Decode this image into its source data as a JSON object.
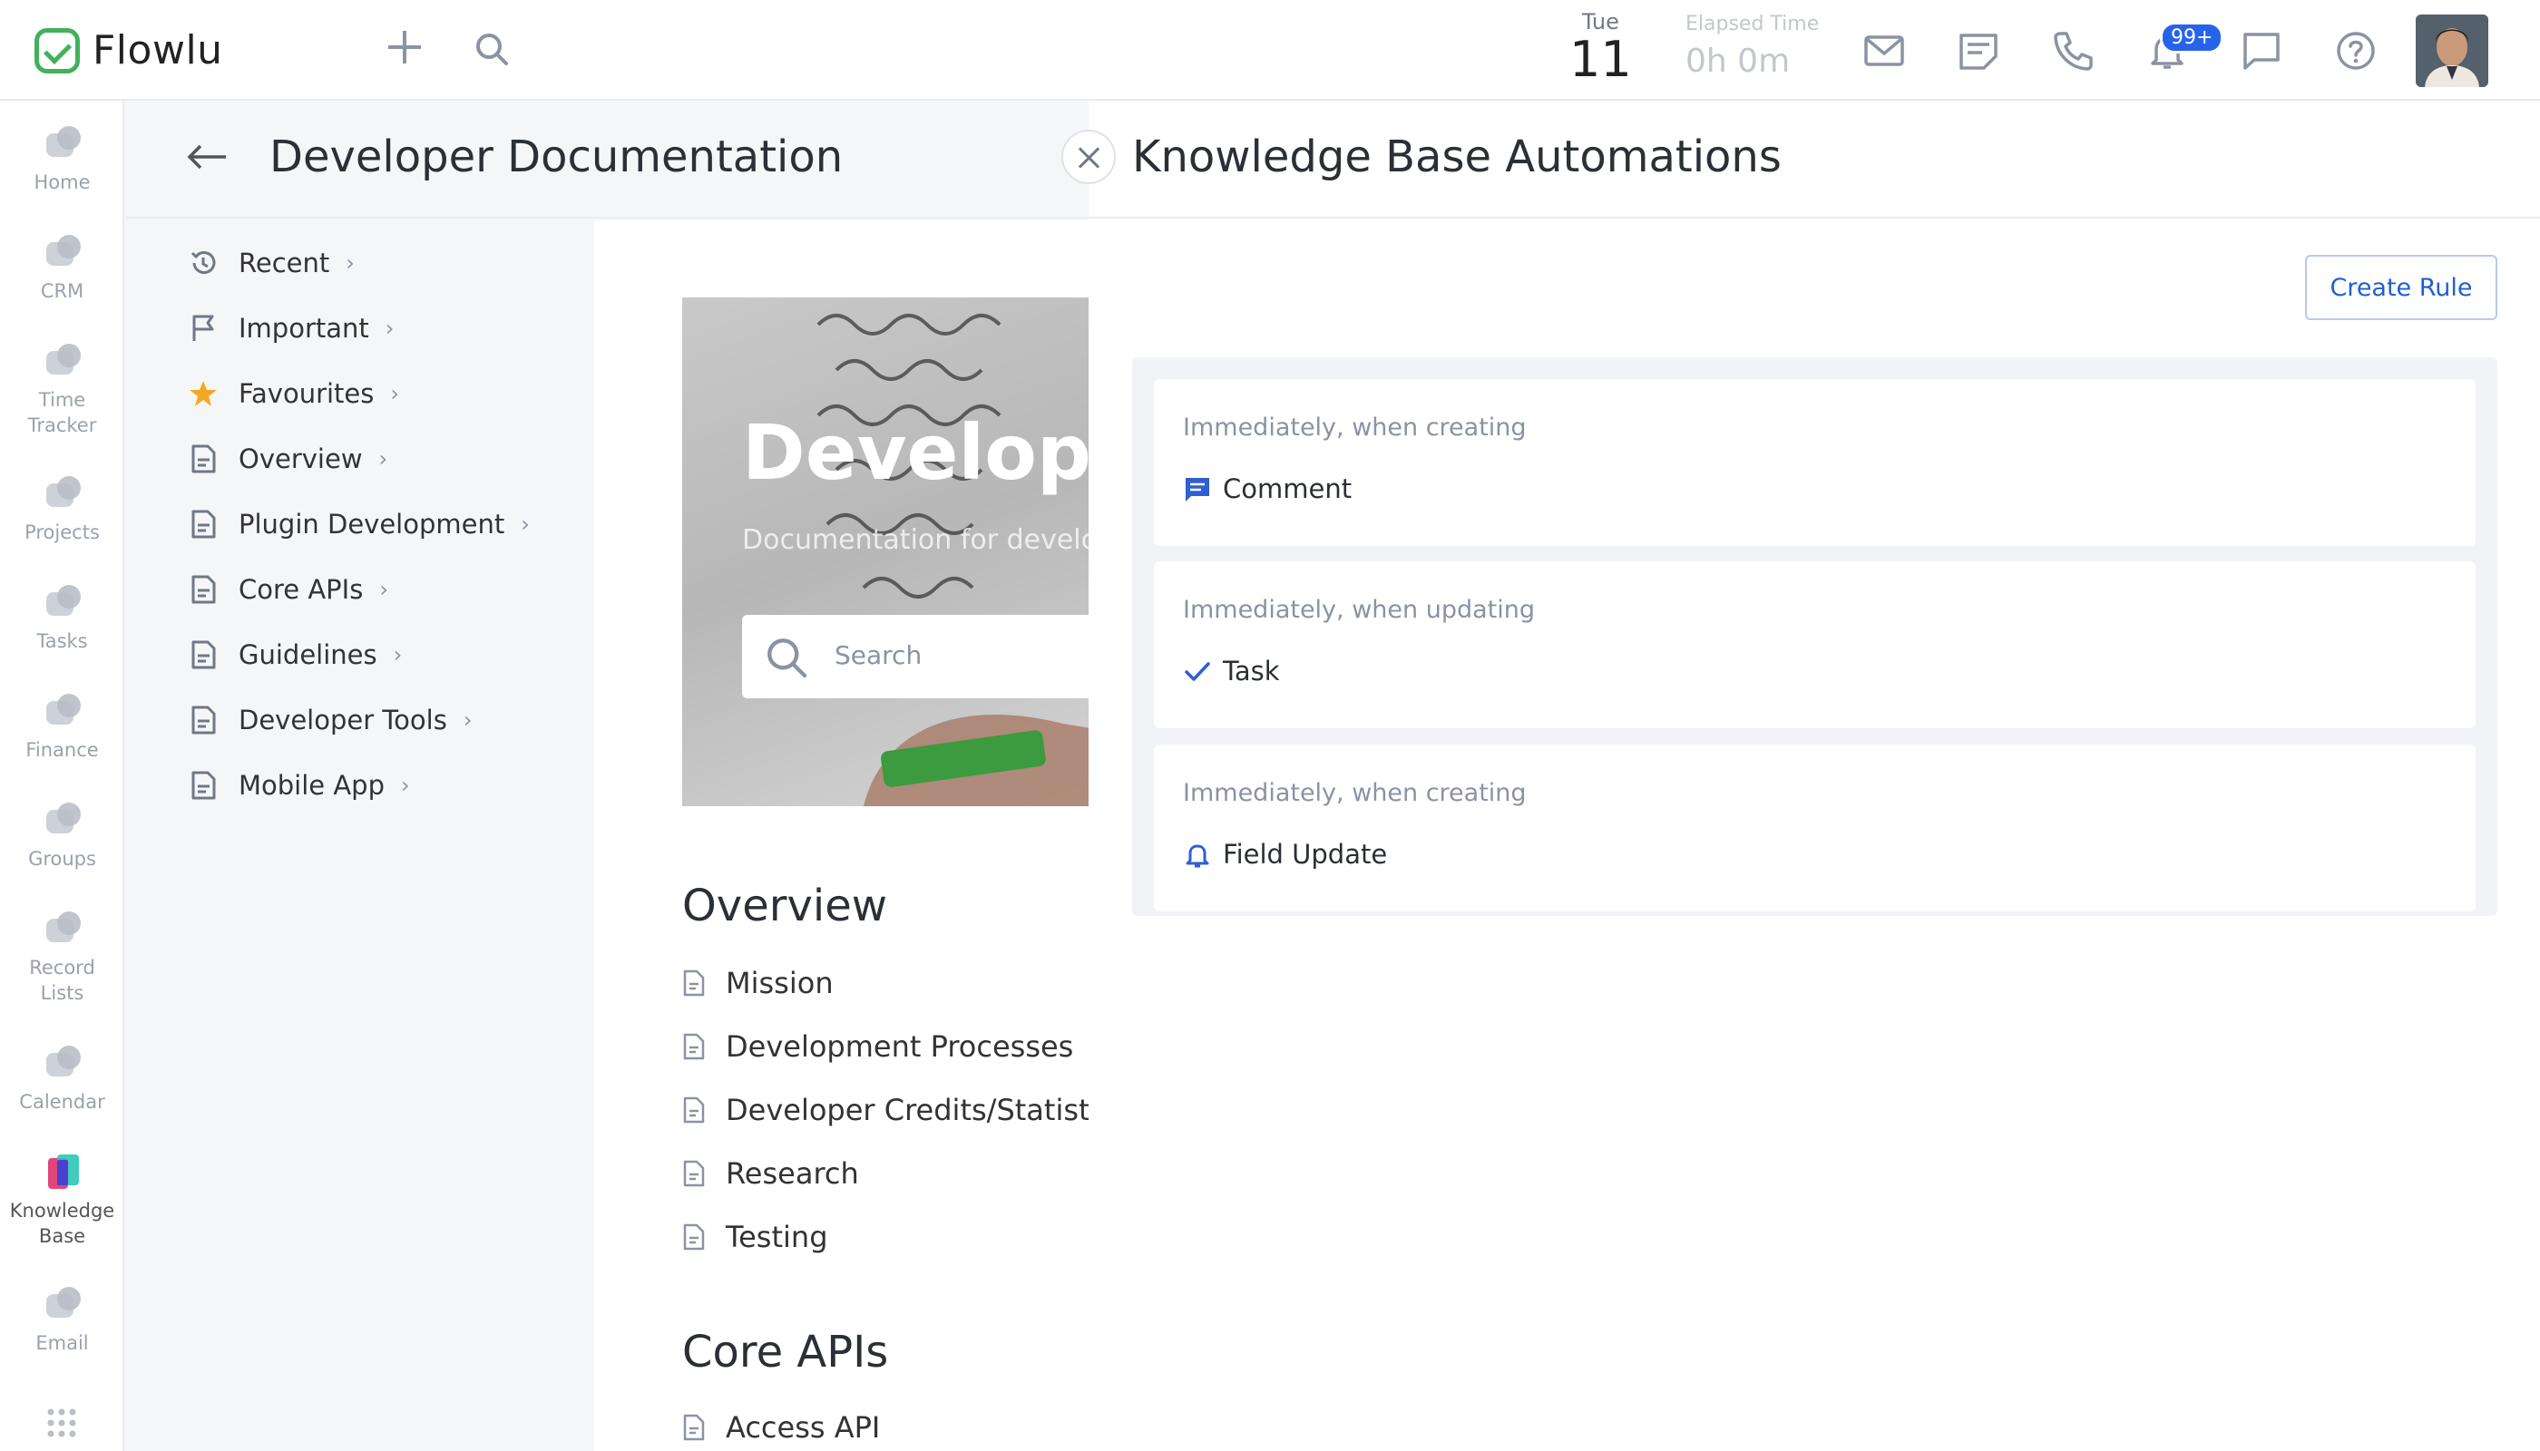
{
  "app": {
    "name": "Flowlu"
  },
  "topbar": {
    "date": {
      "weekday": "Tue",
      "day": "11"
    },
    "elapsed": {
      "label": "Elapsed Time",
      "value": "0h 0m"
    },
    "notification_count": "99+",
    "icons": [
      "plus-icon",
      "search-icon",
      "mail-icon",
      "notes-icon",
      "phone-icon",
      "bell-icon",
      "chat-icon",
      "help-icon"
    ]
  },
  "leftnav": {
    "items": [
      {
        "label": "Home",
        "icon": "home-icon"
      },
      {
        "label": "CRM",
        "icon": "crm-icon"
      },
      {
        "label": "Time Tracker",
        "icon": "time-tracker-icon"
      },
      {
        "label": "Projects",
        "icon": "projects-icon"
      },
      {
        "label": "Tasks",
        "icon": "tasks-icon"
      },
      {
        "label": "Finance",
        "icon": "finance-icon"
      },
      {
        "label": "Groups",
        "icon": "groups-icon"
      },
      {
        "label": "Record Lists",
        "icon": "record-lists-icon"
      },
      {
        "label": "Calendar",
        "icon": "calendar-icon"
      },
      {
        "label": "Knowledge Base",
        "icon": "knowledge-base-icon",
        "active": true
      },
      {
        "label": "Email",
        "icon": "email-icon"
      }
    ]
  },
  "doc": {
    "title": "Developer Documentation",
    "tree": [
      {
        "label": "Recent",
        "icon": "history-icon"
      },
      {
        "label": "Important",
        "icon": "flag-icon"
      },
      {
        "label": "Favourites",
        "icon": "star-icon"
      },
      {
        "label": "Overview",
        "icon": "document-icon"
      },
      {
        "label": "Plugin Development",
        "icon": "document-icon"
      },
      {
        "label": "Core APIs",
        "icon": "document-icon"
      },
      {
        "label": "Guidelines",
        "icon": "document-icon"
      },
      {
        "label": "Developer Tools",
        "icon": "document-icon"
      },
      {
        "label": "Mobile App",
        "icon": "document-icon"
      }
    ],
    "hero": {
      "title": "Developer",
      "subtitle": "Documentation for develc",
      "search_placeholder": "Search"
    },
    "sections": [
      {
        "title": "Overview",
        "links": [
          "Mission",
          "Development Processes",
          "Developer Credits/Statistic",
          "Research",
          "Testing"
        ]
      },
      {
        "title": "Core APIs",
        "links": [
          "Access API"
        ]
      }
    ]
  },
  "panel": {
    "title": "Knowledge Base Automations",
    "create_button": "Create Rule",
    "rules": [
      {
        "when": "Immediately, when creating",
        "action": "Comment",
        "icon": "comment-icon"
      },
      {
        "when": "Immediately, when updating",
        "action": "Task",
        "icon": "check-icon"
      },
      {
        "when": "Immediately, when creating",
        "action": "Field Update",
        "icon": "bell-icon"
      }
    ]
  },
  "colors": {
    "brand": "#43b05c",
    "accent": "#2563eb",
    "muted": "#8a93a3"
  }
}
